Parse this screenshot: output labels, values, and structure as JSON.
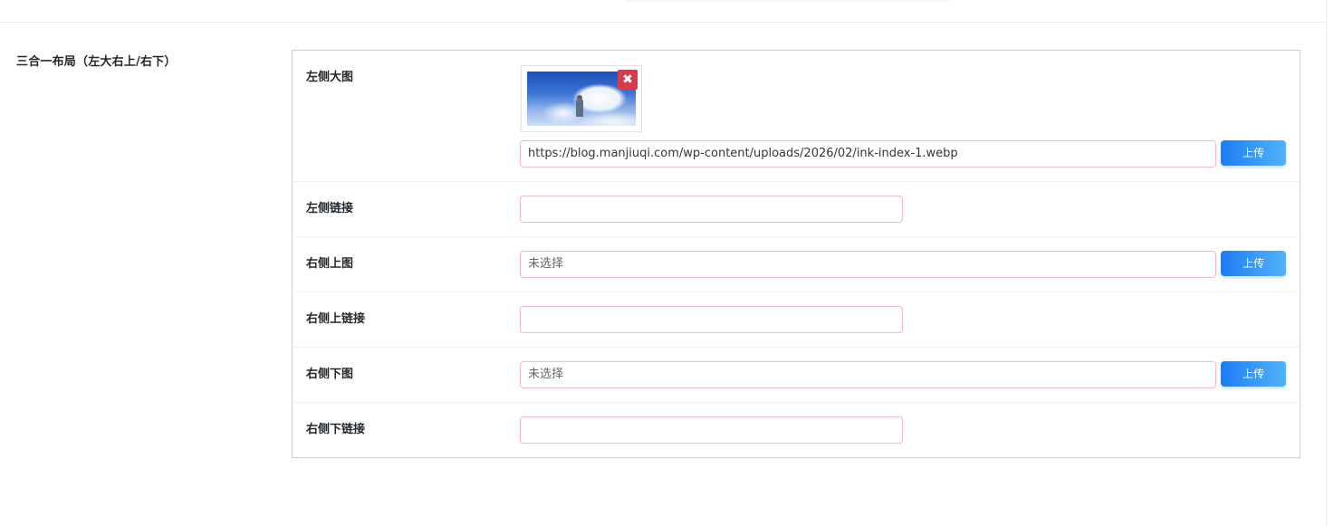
{
  "section": {
    "title": "三合一布局（左大右上/右下）"
  },
  "fields": {
    "left_image": {
      "label": "左侧大图",
      "value": "https://blog.manjiuqi.com/wp-content/uploads/2026/02/ink-index-1.webp",
      "upload_label": "上传",
      "remove_symbol": "✖"
    },
    "left_link": {
      "label": "左侧链接",
      "value": ""
    },
    "right_top_image": {
      "label": "右侧上图",
      "placeholder": "未选择",
      "upload_label": "上传"
    },
    "right_top_link": {
      "label": "右侧上链接",
      "value": ""
    },
    "right_bottom_image": {
      "label": "右侧下图",
      "placeholder": "未选择",
      "upload_label": "上传"
    },
    "right_bottom_link": {
      "label": "右侧下链接",
      "value": ""
    }
  },
  "colors": {
    "input_border": "#f2b8c9",
    "button_start": "#1e7cf2",
    "button_end": "#52b3fa",
    "remove_button": "#d43c4c"
  }
}
